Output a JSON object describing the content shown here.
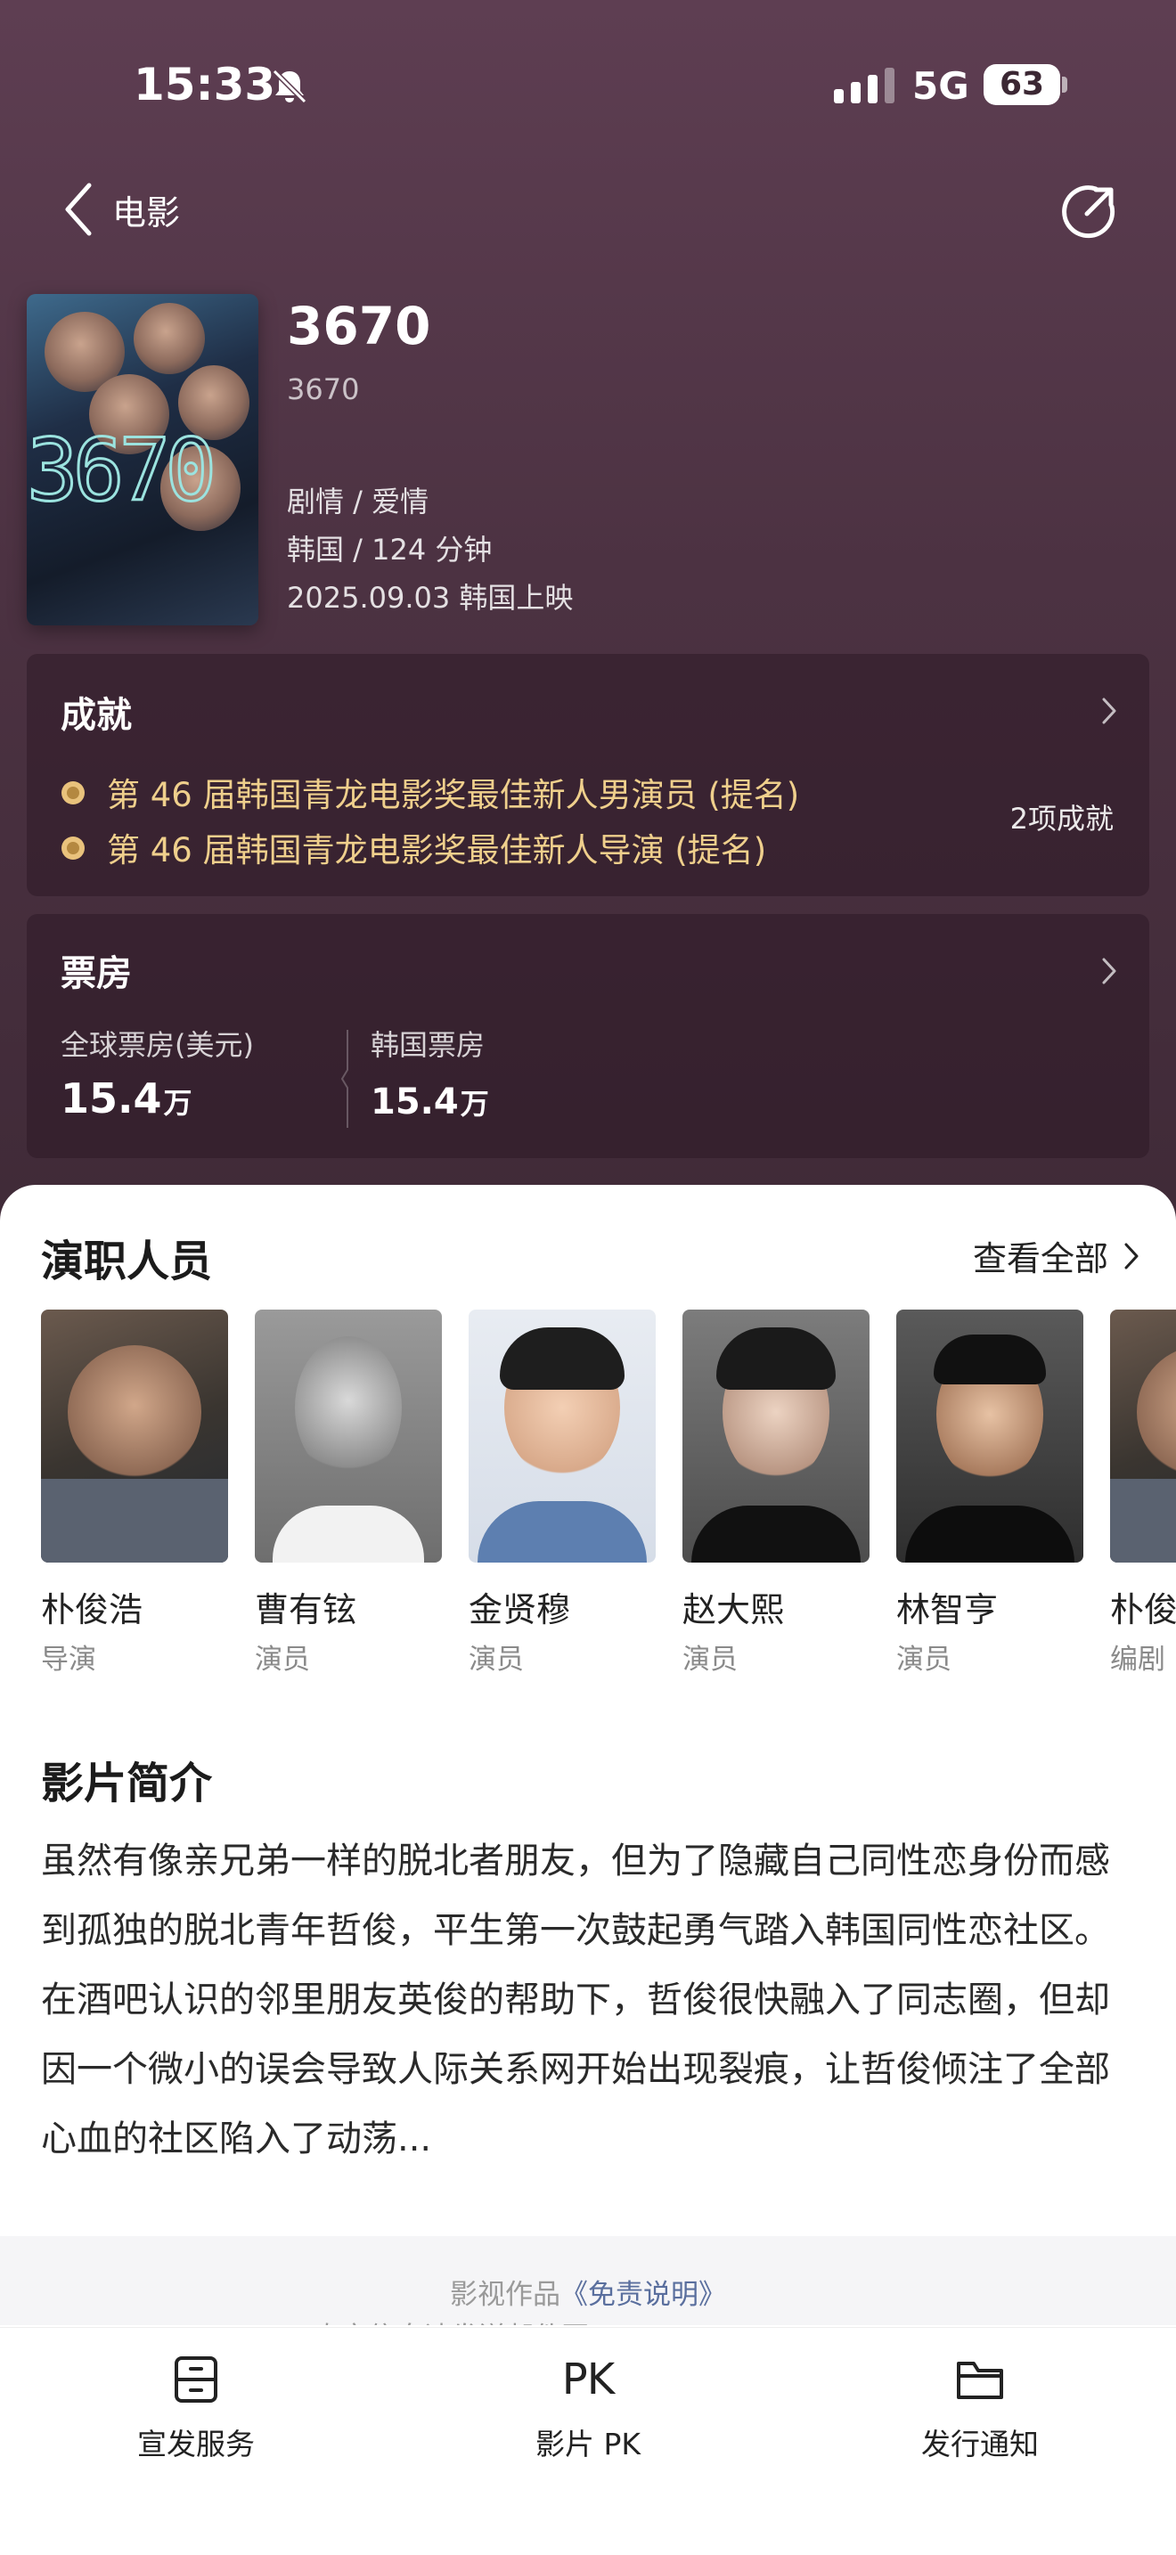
{
  "status_bar": {
    "time": "15:33",
    "network": "5G",
    "battery": "63"
  },
  "nav": {
    "back_label": "电影"
  },
  "movie": {
    "title": "3670",
    "original_title": "3670",
    "genre": "剧情 / 爱情",
    "region_duration": "韩国 / 124 分钟",
    "release": "2025.09.03 韩国上映",
    "poster_number": "3670"
  },
  "achievements": {
    "title": "成就",
    "items": [
      "第 46 届韩国青龙电影奖最佳新人男演员 (提名)",
      "第 46 届韩国青龙电影奖最佳新人导演 (提名)"
    ],
    "count": "2项成就"
  },
  "box_office": {
    "title": "票房",
    "global_label": "全球票房(美元)",
    "global_value": "15.4",
    "global_unit": "万",
    "korea_label": "韩国票房",
    "korea_value": "15.4",
    "korea_unit": "万"
  },
  "cast": {
    "title": "演职人员",
    "view_all": "查看全部",
    "members": [
      {
        "name": "朴俊浩",
        "role": "导演"
      },
      {
        "name": "曹有铉",
        "role": "演员"
      },
      {
        "name": "金贤穆",
        "role": "演员"
      },
      {
        "name": "赵大熙",
        "role": "演员"
      },
      {
        "name": "林智亨",
        "role": "演员"
      },
      {
        "name": "朴俊",
        "role": "编剧"
      }
    ]
  },
  "synopsis": {
    "title": "影片简介",
    "text": "虽然有像亲兄弟一样的脱北者朋友，但为了隐藏自己同性恋身份而感到孤独的脱北青年哲俊，平生第一次鼓起勇气踏入韩国同性恋社区。在酒吧认识的邻里朋友英俊的帮助下，哲俊很快融入了同志圈，但却因一个微小的误会导致人际关系网开始出现裂痕，让哲俊倾注了全部心血的社区陷入了动荡..."
  },
  "footer": {
    "prefix": "影视作品",
    "link": "《免责说明》",
    "line2": "*真实信息请发送邮件至 zilian@maoyan.com"
  },
  "tabbar": {
    "items": [
      {
        "label": "宣发服务",
        "icon": "drawer-icon"
      },
      {
        "label": "影片 PK",
        "icon": "pk-icon",
        "glyph": "PK"
      },
      {
        "label": "发行通知",
        "icon": "folder-icon"
      }
    ]
  },
  "colors": {
    "hero_bg": "#4c3242",
    "accent_gold": "#efcf8c",
    "link": "#5a6f9e"
  }
}
